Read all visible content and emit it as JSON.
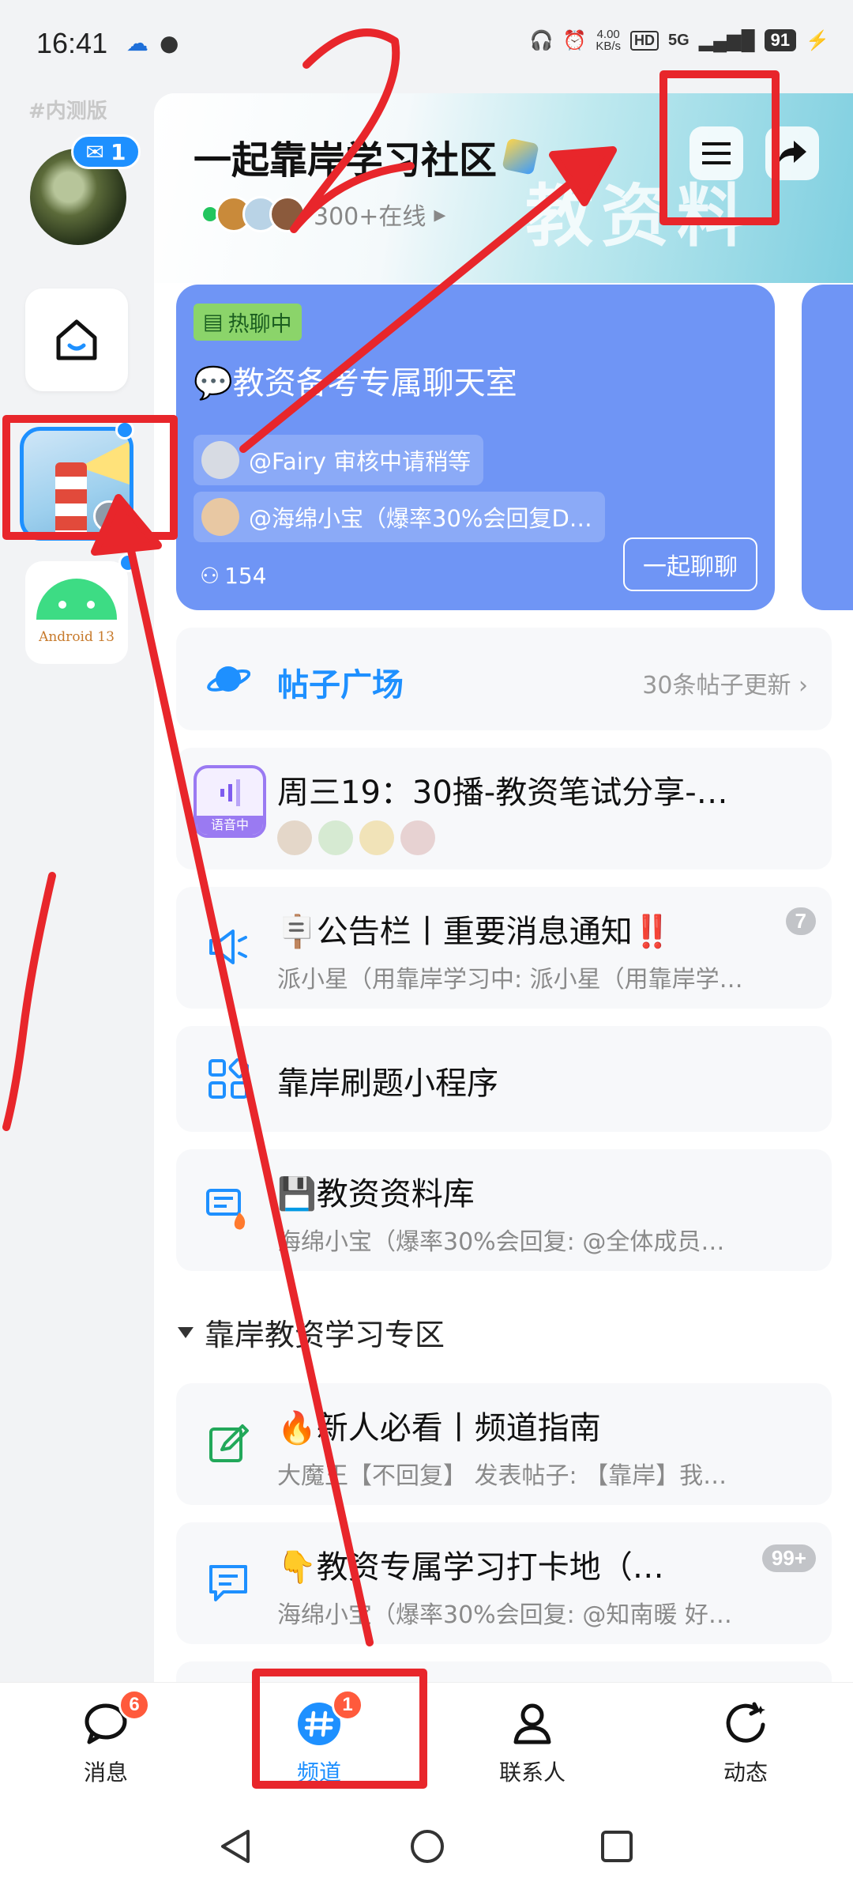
{
  "status": {
    "time": "16:41",
    "speed_value": "4.00",
    "speed_unit": "KB/s",
    "hd": "HD",
    "network": "5G",
    "battery": "91"
  },
  "rail": {
    "beta_label": "#内测版",
    "mail_badge": "1",
    "android_label": "Android 13"
  },
  "guild": {
    "title": "一起靠岸学习社区",
    "online_text": "300+在线",
    "banner_watermark": "教资料"
  },
  "chat_cards": [
    {
      "tag": "热聊中",
      "name": "💬教资备考专属聊天室",
      "messages": [
        "@Fairy 审核中请稍等",
        "@海绵小宝（爆率30%会回复D…"
      ],
      "members": "154",
      "join_label": "一起聊聊"
    }
  ],
  "channels": {
    "square": {
      "title": "帖子广场",
      "more": "30条帖子更新"
    },
    "voice": {
      "title": "周三19：30播-教资笔试分享-…",
      "tag": "语音中"
    },
    "announcement": {
      "title": "🪧公告栏丨重要消息通知‼️",
      "subtitle": "派小星（用靠岸学习中: 派小星（用靠岸学…",
      "badge": "7"
    },
    "miniprogram": {
      "title": "靠岸刷题小程序"
    },
    "library": {
      "title": "💾教资资料库",
      "subtitle": "海绵小宝（爆率30%会回复: @全体成员…"
    },
    "section_title": "靠岸教资学习专区",
    "guide": {
      "title": "🔥新人必看丨频道指南",
      "subtitle": "大魔王【不回复】 发表帖子: 【靠岸】我…"
    },
    "checkin": {
      "title": "👇教资专属学习打卡地（…",
      "subtitle": "海绵小宝（爆率30%会回复: @知南暖 好…",
      "badge": "99+"
    }
  },
  "bottom_nav": {
    "tabs": [
      {
        "label": "消息",
        "badge": "6"
      },
      {
        "label": "频道",
        "badge": "1"
      },
      {
        "label": "联系人"
      },
      {
        "label": "动态"
      }
    ]
  },
  "annotations": {
    "mark_1": "1",
    "mark_2": "2"
  },
  "colors": {
    "accent": "#1e90ff",
    "card": "#6f95f5",
    "annotation": "#e8262b"
  }
}
